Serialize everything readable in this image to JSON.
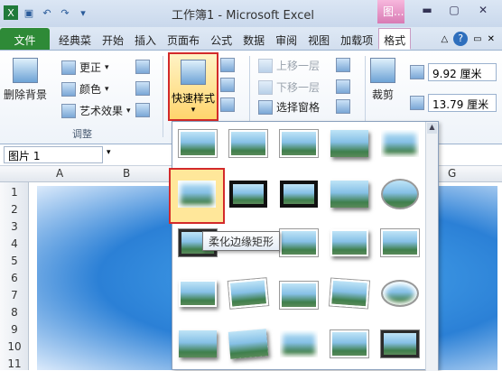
{
  "window": {
    "title": "工作簿1 - Microsoft Excel",
    "context_tab_label": "图..."
  },
  "tabs": [
    {
      "label": "文件"
    },
    {
      "label": "经典菜"
    },
    {
      "label": "开始"
    },
    {
      "label": "插入"
    },
    {
      "label": "页面布"
    },
    {
      "label": "公式"
    },
    {
      "label": "数据"
    },
    {
      "label": "审阅"
    },
    {
      "label": "视图"
    },
    {
      "label": "加载项"
    },
    {
      "label": "格式"
    }
  ],
  "ribbon": {
    "remove_bg": "删除背景",
    "correct": "更正",
    "color": "颜色",
    "art_effects": "艺术效果",
    "adjust_group": "调整",
    "quick_styles": "快速样式",
    "bring_forward": "上移一层",
    "send_backward": "下移一层",
    "selection_pane": "选择窗格",
    "crop": "裁剪",
    "height_value": "9.92 厘米",
    "width_value": "13.79 厘米"
  },
  "formula_bar": {
    "name_box": "图片 1"
  },
  "columns": [
    "A",
    "B",
    "G"
  ],
  "rows": [
    "1",
    "2",
    "3",
    "4",
    "5",
    "6",
    "7",
    "8",
    "9",
    "10",
    "11"
  ],
  "tooltip": "柔化边缘矩形",
  "colors": {
    "file_tab": "#2e8a37",
    "selection_red": "#d32a2a",
    "context_pink": "#d87bb4"
  }
}
